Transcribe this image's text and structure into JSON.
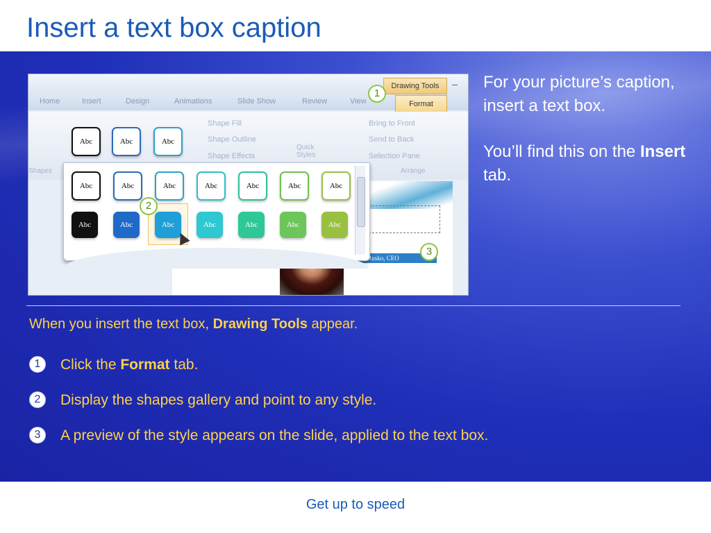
{
  "title": "Insert a text box caption",
  "side": {
    "p1": "For your picture’s caption, insert a text box.",
    "p2_pre": "You’ll find this on the ",
    "p2_bold": "Insert",
    "p2_post": " tab."
  },
  "lead": {
    "pre": "When you insert the text box, ",
    "bold": "Drawing Tools",
    "post": " appear."
  },
  "steps": [
    {
      "num": "1",
      "pre": "Click the ",
      "bold": "Format",
      "post": " tab."
    },
    {
      "num": "2",
      "pre": "Display the shapes gallery and point to any style.",
      "bold": "",
      "post": ""
    },
    {
      "num": "3",
      "pre": "A preview of the style appears on the slide, applied to the text box.",
      "bold": "",
      "post": ""
    }
  ],
  "footer": "Get up to speed",
  "screenshot": {
    "drawing_tools": "Drawing Tools",
    "minimize": "–",
    "tabs": [
      "Home",
      "Insert",
      "Design",
      "Animations",
      "Slide Show",
      "Review",
      "View"
    ],
    "format_tab": "Format",
    "shape_fill": "Shape Fill",
    "shape_outline": "Shape Outline",
    "shape_effects": "Shape Effects",
    "quick_styles": "Quick Styles",
    "bring_to_front": "Bring to Front",
    "send_to_back": "Send to Back",
    "selection_pane": "Selection Pane",
    "group_shapes": "Shapes",
    "group_arrange": "Arrange",
    "abc": "Abc",
    "caption": "Amy Rusko, CEO",
    "callouts": [
      "1",
      "2",
      "3"
    ]
  },
  "colors": {
    "title": "#1a5bb8",
    "panel": "#1f2fb8",
    "accent_text": "#ffd24a",
    "callout_ring": "#8cc63f"
  }
}
